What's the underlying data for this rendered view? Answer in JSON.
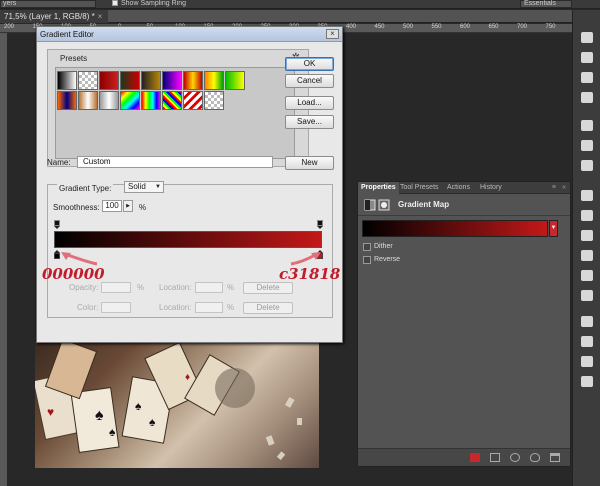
{
  "options_bar": {
    "layers_select": "yers",
    "sample_ring_label": "Show Sampling Ring",
    "workspace": "Essentials"
  },
  "doc_tab": {
    "title": "71,5% (Layer 1, RGB/8) *",
    "close": "×"
  },
  "ruler": {
    "ticks": [
      "200",
      "150",
      "100",
      "50",
      "0",
      "50",
      "100",
      "150",
      "200",
      "250",
      "300",
      "350",
      "400",
      "450",
      "500",
      "550",
      "600",
      "650",
      "700",
      "750"
    ]
  },
  "gradient_editor": {
    "title": "Gradient Editor",
    "close": "×",
    "presets_label": "Presets",
    "gear": "✲",
    "buttons": {
      "ok": "OK",
      "cancel": "Cancel",
      "load": "Load...",
      "save": "Save...",
      "new": "New"
    },
    "name_label": "Name:",
    "name_value": "Custom",
    "gradient_type_label": "Gradient Type:",
    "gradient_type_value": "Solid",
    "smoothness_label": "Smoothness:",
    "smoothness_value": "100",
    "smoothness_unit": "%",
    "stops": {
      "opacity_label": "Opacity:",
      "opacity_unit": "%",
      "location_label": "Location:",
      "location_unit": "%",
      "color_label": "Color:",
      "delete": "Delete"
    },
    "gradient_start": "#000000",
    "gradient_end": "#c31818",
    "annotation_left": "000000",
    "annotation_right": "c31818"
  },
  "properties_panel": {
    "tabs": [
      "Properties",
      "Tool Presets",
      "Actions",
      "History"
    ],
    "menu": "≡",
    "close": "«",
    "title": "Gradient Map",
    "dither_label": "Dither",
    "reverse_label": "Reverse",
    "accent_red": "#c8282c"
  }
}
